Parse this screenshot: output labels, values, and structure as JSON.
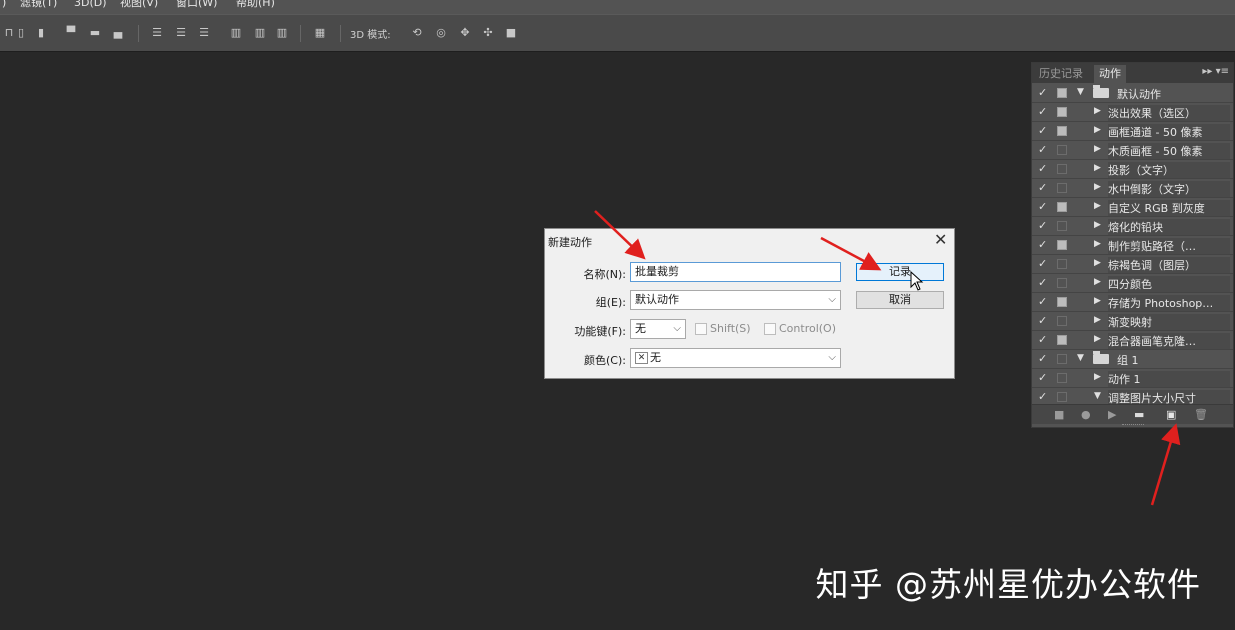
{
  "menubar": {
    "items": [
      ") ",
      "滤镜(T)",
      "3D(D)",
      "视图(V)",
      "窗口(W)",
      "帮助(H)"
    ]
  },
  "optionsbar": {
    "mode3d_label": "3D 模式:"
  },
  "panel": {
    "tabs": [
      "历史记录",
      "动作"
    ],
    "menu_icon": "▸▸ ▾≡",
    "rows": [
      {
        "check": "✓",
        "dialog": true,
        "expanded": true,
        "folder": true,
        "label": "默认动作"
      },
      {
        "check": "✓",
        "dialog": true,
        "label": "淡出效果（选区）"
      },
      {
        "check": "✓",
        "dialog": true,
        "label": "画框通道 - 50 像素"
      },
      {
        "check": "✓",
        "dialog": false,
        "label": "木质画框 - 50 像素"
      },
      {
        "check": "✓",
        "dialog": false,
        "label": "投影（文字）"
      },
      {
        "check": "✓",
        "dialog": false,
        "label": "水中倒影（文字）"
      },
      {
        "check": "✓",
        "dialog": true,
        "label": "自定义 RGB 到灰度"
      },
      {
        "check": "✓",
        "dialog": false,
        "label": "熔化的铅块"
      },
      {
        "check": "✓",
        "dialog": true,
        "label": "制作剪贴路径（…"
      },
      {
        "check": "✓",
        "dialog": false,
        "label": "棕褐色调（图层）"
      },
      {
        "check": "✓",
        "dialog": false,
        "label": "四分颜色"
      },
      {
        "check": "✓",
        "dialog": true,
        "label": "存储为 Photoshop…"
      },
      {
        "check": "✓",
        "dialog": false,
        "label": "渐变映射"
      },
      {
        "check": "✓",
        "dialog": true,
        "label": "混合器画笔克隆…"
      },
      {
        "check": "✓",
        "dialog": false,
        "expanded": true,
        "folder": true,
        "label": "组 1"
      },
      {
        "check": "✓",
        "dialog": false,
        "label": "动作 1"
      },
      {
        "check": "✓",
        "dialog": false,
        "expanded": true,
        "label": "调整图片大小尺寸"
      }
    ]
  },
  "dialog": {
    "title": "新建动作",
    "close": "✕",
    "name_label": "名称(N):",
    "name_value": "批量裁剪",
    "group_label": "组(E):",
    "group_value": "默认动作",
    "fkey_label": "功能键(F):",
    "fkey_value": "无",
    "shift_label": "Shift(S)",
    "control_label": "Control(O)",
    "color_label": "颜色(C):",
    "color_value": "无",
    "record_label": "记录",
    "cancel_label": "取消"
  },
  "watermark": "知乎 @苏州星优办公软件",
  "colors": {
    "arrow": "#e0201e",
    "canvas": "#282828",
    "panel": "#535353"
  }
}
